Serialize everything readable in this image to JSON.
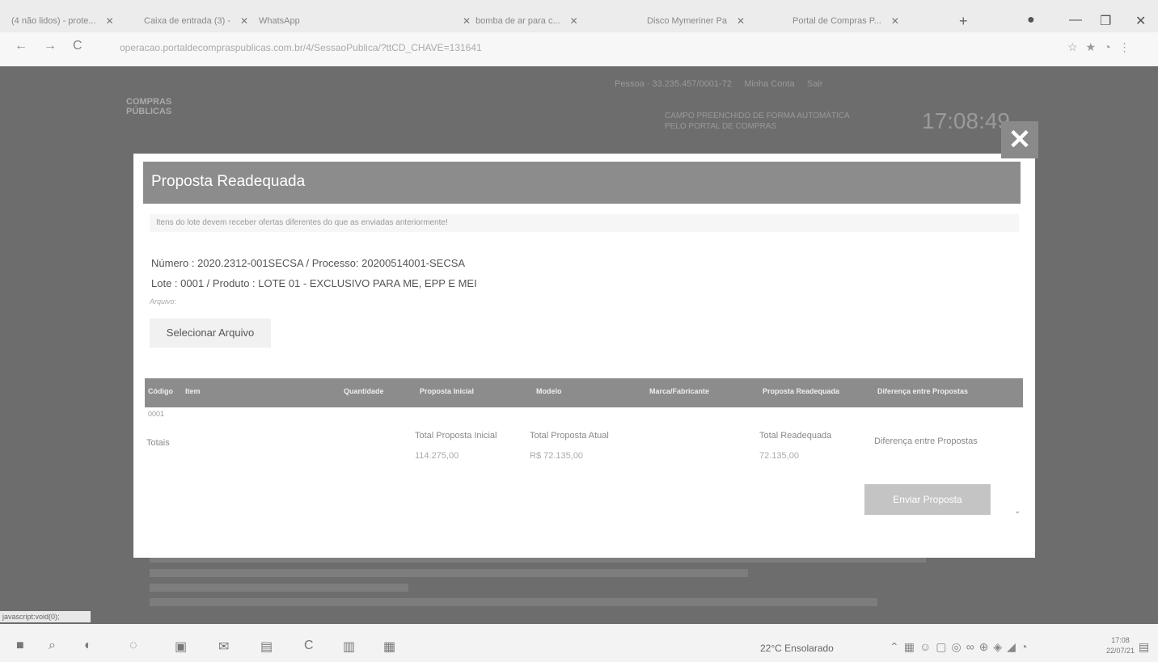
{
  "browser": {
    "tabs": [
      {
        "label": "(4 não lidos) - prote..."
      },
      {
        "label": "Caixa de entrada (3) -"
      },
      {
        "label": "WhatsApp"
      },
      {
        "label": "bomba de ar para c..."
      },
      {
        "label": "Disco Mymeriner Pa"
      },
      {
        "label": "Portal de Compras P..."
      }
    ],
    "url": "operacao.portaldecompraspublicas.com.br/4/SessaoPublica/?ttCD_CHAVE=131641"
  },
  "page": {
    "logo_line1": "COMPRAS",
    "logo_line2": "PÚBLICAS",
    "user_info": "Pessoa · 33.235.457/0001-72",
    "user_menu": "Minha Conta",
    "user_exit": "Sair",
    "notice": "CAMPO PREENCHIDO DE FORMA AUTOMÁTICA PELO PORTAL DE COMPRAS",
    "clock": "17:08:49"
  },
  "modal": {
    "title": "Proposta Readequada",
    "warning": "Itens do lote devem receber ofertas diferentes do que as enviadas anteriormente!",
    "numero_line": "Número : 2020.2312-001SECSA / Processo: 20200514001-SECSA",
    "lote_line": "Lote : 0001 / Produto : LOTE 01 - EXCLUSIVO PARA ME, EPP E MEI",
    "file_label": "Arquivo:",
    "file_button": "Selecionar Arquivo",
    "columns": [
      "Código",
      "Item",
      "Quantidade",
      "Proposta Inicial",
      "Modelo",
      "Marca/Fabricante",
      "Proposta Readequada",
      "Diferença entre Propostas"
    ],
    "row": [
      "0001",
      "",
      "",
      "",
      "",
      "",
      "",
      ""
    ],
    "totals_label": "Totais",
    "total_inicial_label": "Total Proposta Inicial",
    "total_inicial_value": "114.275,00",
    "total_atual_label": "Total Proposta Atual",
    "total_atual_value": "R$ 72.135,00",
    "total_readequada_label": "Total Readequada",
    "total_readequada_value": "72.135,00",
    "diferenca_label": "Diferença entre Propostas",
    "send_button": "Enviar Proposta",
    "close_symbol": "✕"
  },
  "status_text": "javascript:void(0);",
  "taskbar": {
    "weather": "22°C  Ensolarado",
    "time": "17:08",
    "date": "22/07/21"
  }
}
